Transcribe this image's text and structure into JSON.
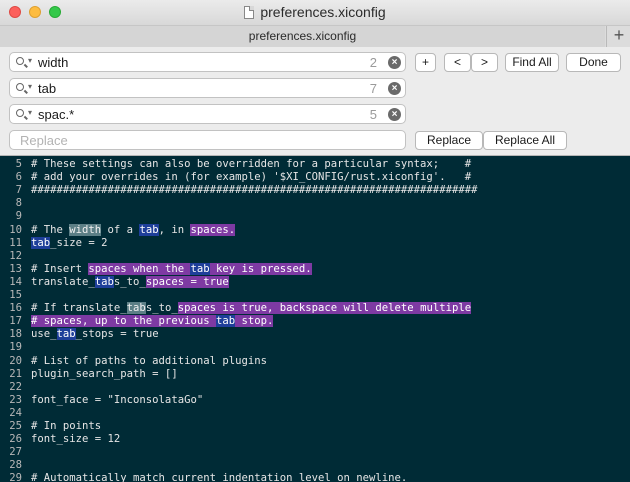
{
  "window": {
    "title": "preferences.xiconfig"
  },
  "tabs": [
    {
      "label": "preferences.xiconfig"
    }
  ],
  "tab_add_label": "+",
  "find": {
    "queries": [
      {
        "value": "width",
        "count": "2"
      },
      {
        "value": "tab",
        "count": "7"
      },
      {
        "value": "spac.*",
        "count": "5"
      }
    ],
    "replace_placeholder": "Replace",
    "add_label": "+",
    "prev_label": "<",
    "next_label": ">",
    "find_all_label": "Find All",
    "done_label": "Done",
    "replace_label": "Replace",
    "replace_all_label": "Replace All"
  },
  "colors": {
    "editor_bg": "#002b36",
    "highlight_width": "#5c7f86",
    "highlight_tab": "#1e3f9a",
    "highlight_spaces": "#7e3aa3"
  },
  "editor": {
    "lines": [
      {
        "n": "5",
        "segs": [
          {
            "t": "# These settings can also be overridden for a particular syntax;    #"
          }
        ]
      },
      {
        "n": "6",
        "segs": [
          {
            "t": "# add your overrides in (for example) '$XI_CONFIG/rust.xiconfig'.   #"
          }
        ]
      },
      {
        "n": "7",
        "segs": [
          {
            "t": "######################################################################"
          }
        ]
      },
      {
        "n": "8",
        "segs": []
      },
      {
        "n": "9",
        "segs": []
      },
      {
        "n": "10",
        "segs": [
          {
            "t": "# The "
          },
          {
            "t": "width",
            "h": "w"
          },
          {
            "t": " of a "
          },
          {
            "t": "tab",
            "h": "t"
          },
          {
            "t": ", in "
          },
          {
            "t": "spaces.",
            "h": "s"
          }
        ]
      },
      {
        "n": "11",
        "segs": [
          {
            "t": "tab",
            "h": "t"
          },
          {
            "t": "_size = 2"
          }
        ]
      },
      {
        "n": "12",
        "segs": []
      },
      {
        "n": "13",
        "segs": [
          {
            "t": "# Insert "
          },
          {
            "t": "spaces when the ",
            "h": "s"
          },
          {
            "t": "tab",
            "h": "t"
          },
          {
            "t": " key is pressed.",
            "h": "s"
          }
        ]
      },
      {
        "n": "14",
        "segs": [
          {
            "t": "translate_"
          },
          {
            "t": "tab",
            "h": "t"
          },
          {
            "t": "s_to_"
          },
          {
            "t": "spaces = true",
            "h": "s"
          }
        ]
      },
      {
        "n": "15",
        "segs": []
      },
      {
        "n": "16",
        "segs": [
          {
            "t": "# If translate_"
          },
          {
            "t": "tab",
            "h": "w"
          },
          {
            "t": "s_to_"
          },
          {
            "t": "spaces is true, backspace will delete multiple",
            "h": "s"
          }
        ]
      },
      {
        "n": "17",
        "segs": [
          {
            "t": "# spaces, up to the previous ",
            "h": "s"
          },
          {
            "t": "tab",
            "h": "t"
          },
          {
            "t": " stop.",
            "h": "s"
          }
        ]
      },
      {
        "n": "18",
        "segs": [
          {
            "t": "use_"
          },
          {
            "t": "tab",
            "h": "t"
          },
          {
            "t": "_stops = true"
          }
        ]
      },
      {
        "n": "19",
        "segs": []
      },
      {
        "n": "20",
        "segs": [
          {
            "t": "# List of paths to additional plugins"
          }
        ]
      },
      {
        "n": "21",
        "segs": [
          {
            "t": "plugin_search_path = []"
          }
        ]
      },
      {
        "n": "22",
        "segs": []
      },
      {
        "n": "23",
        "segs": [
          {
            "t": "font_face = \"InconsolataGo\""
          }
        ]
      },
      {
        "n": "24",
        "segs": []
      },
      {
        "n": "25",
        "segs": [
          {
            "t": "# In points"
          }
        ]
      },
      {
        "n": "26",
        "segs": [
          {
            "t": "font_size = 12"
          }
        ]
      },
      {
        "n": "27",
        "segs": []
      },
      {
        "n": "28",
        "segs": []
      },
      {
        "n": "29",
        "segs": [
          {
            "t": "# Automatically match current indentation level on newline."
          }
        ]
      }
    ]
  }
}
